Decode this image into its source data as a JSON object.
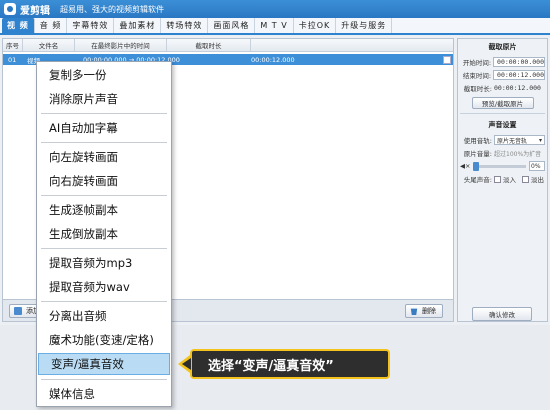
{
  "app": {
    "name": "爱剪辑",
    "slogan": "超易用、强大的视频剪辑软件"
  },
  "tabs": [
    "视 频",
    "音 频",
    "字幕特效",
    "叠加素材",
    "转场特效",
    "画面风格",
    "M T V",
    "卡拉OK",
    "升级与服务"
  ],
  "list": {
    "headers": [
      "序号",
      "文件名",
      "在最终影片中的时间",
      "截取时长"
    ],
    "rows": [
      {
        "index": "01",
        "name": "视频",
        "time": "00:00:00.000 → 00:00:12.000",
        "duration": "00:00:12.000"
      }
    ]
  },
  "toolbar": {
    "add_label": "添加",
    "delete_label": "删除"
  },
  "right_panel": {
    "clip_title": "截取原片",
    "start_label": "开始时间:",
    "start_value": "00:00:00.000",
    "end_label": "结束时间:",
    "end_value": "00:00:12.000",
    "dur_label": "截取时长:",
    "dur_value": "00:00:12.000",
    "preview_btn": "预览/截取原片",
    "audio_title": "声音设置",
    "track_label": "使用音轨:",
    "track_value": "原片无音轨",
    "vol_label": "原片音量:",
    "vol_hint": "超过100%为扩音",
    "vol_pct": "0%",
    "fade_label": "头尾声音:",
    "fade_in": "淡入",
    "fade_out": "淡出",
    "confirm_btn": "确认修改"
  },
  "context_menu": {
    "items": [
      "复制多一份",
      "消除原片声音",
      "AI自动加字幕",
      "向左旋转画面",
      "向右旋转画面",
      "生成逐帧副本",
      "生成倒放副本",
      "提取音频为mp3",
      "提取音频为wav",
      "分离出音频",
      "魔术功能(变速/定格)",
      "变声/逼真音效",
      "媒体信息"
    ],
    "highlighted": "变声/逼真音效"
  },
  "callout": {
    "text": "选择“变声/逼真音效”"
  },
  "colors": {
    "accent": "#2f82ce",
    "highlight": "#b9dbf3",
    "callout_border": "#f4c21d",
    "callout_bg": "#2e2e2e"
  }
}
